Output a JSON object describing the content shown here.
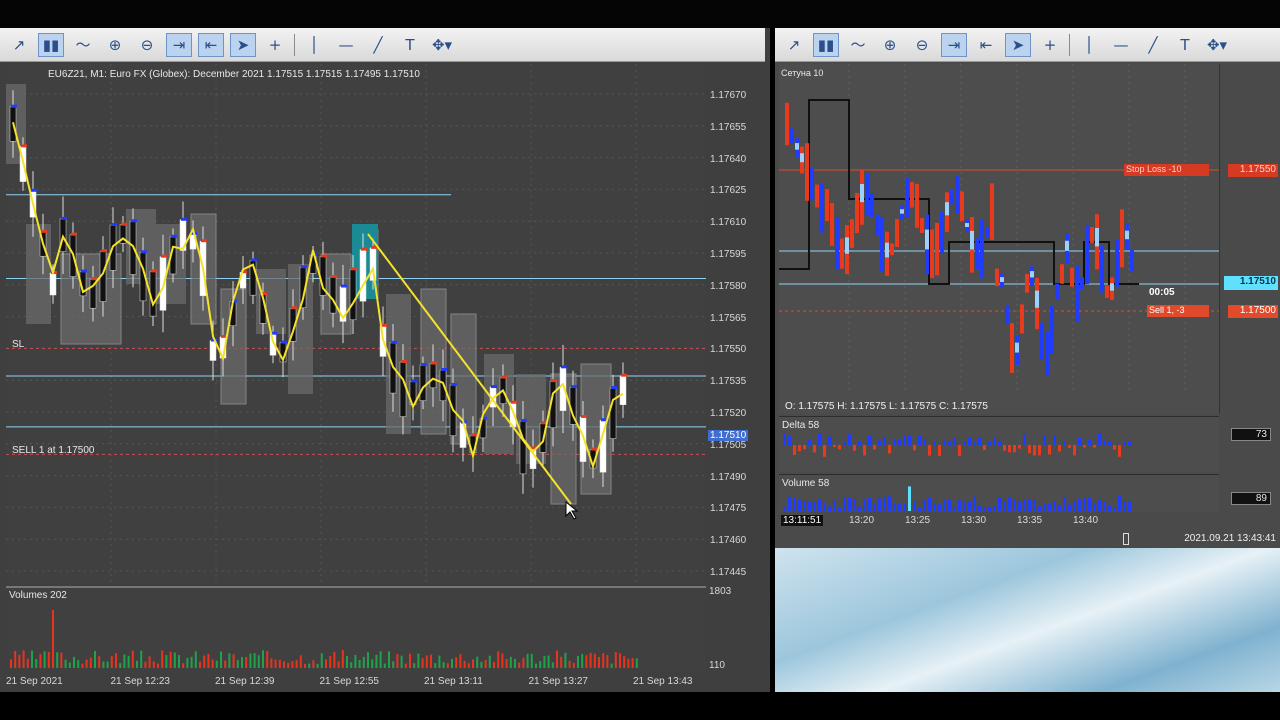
{
  "left": {
    "header": "EU6Z21, M1:  Euro FX (Globex): December 2021  1.17515 1.17515 1.17495 1.17510",
    "price_labels": [
      "1.17670",
      "1.17655",
      "1.17640",
      "1.17625",
      "1.17610",
      "1.17595",
      "1.17580",
      "1.17565",
      "1.17550",
      "1.17535",
      "1.17520",
      "1.17505",
      "1.17490",
      "1.17475",
      "1.17460",
      "1.17445"
    ],
    "current_price": "1.17510",
    "sl_label": "SL",
    "sell_label": "SELL 1 at 1.17500",
    "volumes_label": "Volumes 202",
    "volume_axis_top": "1803",
    "volume_axis_bottom": "110",
    "time_labels": [
      "21 Sep 2021",
      "21 Sep 12:23",
      "21 Sep 12:39",
      "21 Sep 12:55",
      "21 Sep 13:11",
      "21 Sep 13:27",
      "21 Sep 13:43"
    ]
  },
  "right": {
    "instrument": "Сетуна 10",
    "stop_loss_label": "Stop Loss  -10",
    "stop_loss_price": "1.17550",
    "current_price": "1.17510",
    "timer": "00:05",
    "sell_order_label": "Sell 1, -3",
    "sell_order_price": "1.17500",
    "ohlc": "O: 1.17575   H: 1.17575   L: 1.17575   C: 1.17575",
    "delta_label": "Delta 58",
    "delta_value": "73",
    "volume_label": "Volume 58",
    "volume_value": "89",
    "time_labels": [
      "13:11:51",
      "13:20",
      "13:25",
      "13:30",
      "13:35",
      "13:40"
    ],
    "datetime": "2021.09.21 13:43:41"
  },
  "colors": {
    "accent": "#f5e22b",
    "bull": "#ffffff",
    "bear": "#111111",
    "red": "#e83a1d",
    "blue": "#1f3cff",
    "cyan_line": "#8fd3f4"
  }
}
